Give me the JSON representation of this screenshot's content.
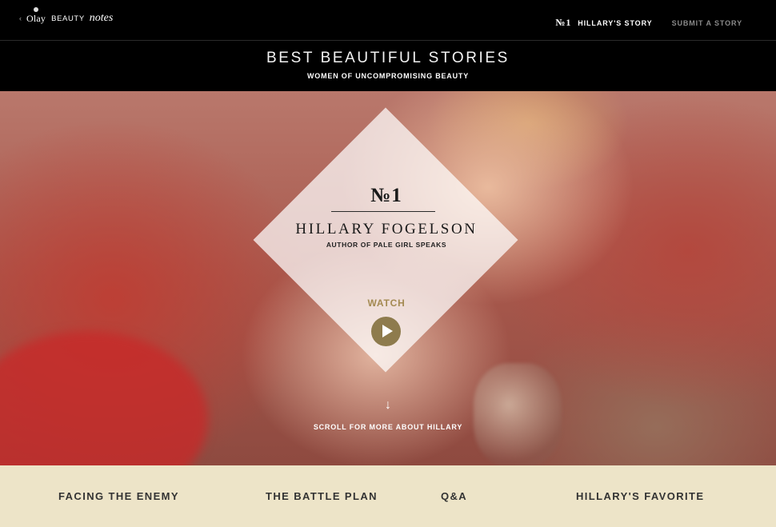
{
  "topnav": {
    "back_arrow": "‹",
    "brand_olay": "Olay",
    "brand_beauty": "BEAUTY",
    "brand_notes": "notes",
    "current_number": "№1",
    "current_story": "HILLARY'S STORY",
    "submit_label": "SUBMIT A STORY"
  },
  "header": {
    "title": "BEST BEAUTIFUL STORIES",
    "subtitle": "WOMEN OF UNCOMPROMISING BEAUTY"
  },
  "hero": {
    "number": "№1",
    "name": "HILLARY FOGELSON",
    "role": "AUTHOR OF PALE GIRL SPEAKS",
    "watch_label": "WATCH",
    "scroll_arrow": "↓",
    "scroll_label": "SCROLL FOR MORE ABOUT HILLARY"
  },
  "sections": [
    {
      "label": "FACING THE ENEMY"
    },
    {
      "label": "THE BATTLE PLAN"
    },
    {
      "label": "Q&A"
    },
    {
      "label": "HILLARY'S FAVORITE"
    }
  ],
  "colors": {
    "accent_gold": "#8e7b4d",
    "bottom_bar": "#ede4c8"
  }
}
